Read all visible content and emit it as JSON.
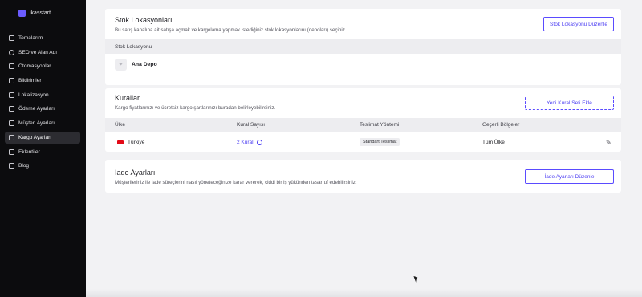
{
  "sidebar": {
    "store_name": "ikasstart",
    "items": [
      {
        "label": "Temalarım",
        "icon": "layout-icon"
      },
      {
        "label": "SEO ve Alan Adı",
        "icon": "globe-icon"
      },
      {
        "label": "Otomasyonlar",
        "icon": "bolt-icon"
      },
      {
        "label": "Bildirimler",
        "icon": "bell-icon"
      },
      {
        "label": "Lokalizasyon",
        "icon": "language-icon"
      },
      {
        "label": "Ödeme Ayarları",
        "icon": "credit-card-icon"
      },
      {
        "label": "Müşteri Ayarları",
        "icon": "users-icon"
      },
      {
        "label": "Kargo Ayarları",
        "icon": "truck-icon",
        "active": true
      },
      {
        "label": "Eklentiler",
        "icon": "grid-icon"
      },
      {
        "label": "Blog",
        "icon": "book-icon"
      }
    ]
  },
  "stock": {
    "title": "Stok Lokasyonları",
    "description": "Bu satış kanalına ait satışa açmak ve kargolama yapmak istediğiniz stok lokasyonlarını (depoları) seçiniz.",
    "button": "Stok Lokasyonu Düzenle",
    "column": "Stok Lokasyonu",
    "location_name": "Ana Depo"
  },
  "rules": {
    "title": "Kurallar",
    "description": "Kargo fiyatlarınızı ve ücretsiz kargo şartlarınızı buradan belirleyebilirsiniz.",
    "button": "Yeni Kural Seti Ekle",
    "columns": [
      "Ülke",
      "Kural Sayısı",
      "Teslimat Yöntemi",
      "Geçerli Bölgeler"
    ],
    "row": {
      "country": "Türkiye",
      "rule_count": "2 Kural",
      "method": "Standart Teslimat",
      "regions": "Tüm Ülke"
    }
  },
  "returns": {
    "title": "İade Ayarları",
    "description": "Müşterileriniz ile iade süreçlerini nasıl yöneteceğinize karar vererek, ciddi bir iş yükünden tasarruf edebilirsiniz.",
    "button": "İade Ayarları Düzenle"
  },
  "colors": {
    "accent": "#4b3df2",
    "sidebar_bg": "#0c0c0e",
    "flag": "#e30a17"
  }
}
